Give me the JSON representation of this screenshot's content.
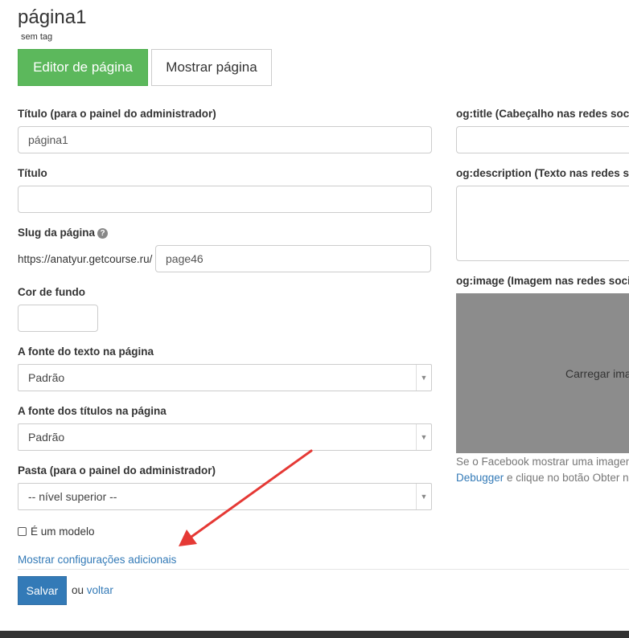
{
  "header": {
    "title": "página1",
    "tagline": "sem tag"
  },
  "tabs": {
    "editor_label": "Editor de página",
    "show_label": "Mostrar página"
  },
  "form": {
    "admin_title_label": "Título (para o painel do administrador)",
    "admin_title_value": "página1",
    "title_label": "Título",
    "title_value": "",
    "slug_label": "Slug da página",
    "slug_help_icon": "question-circle-icon",
    "slug_prefix": "https://anatyur.getcourse.ru/",
    "slug_value": "page46",
    "bg_color_label": "Cor de fundo",
    "bg_color_value": "",
    "text_font_label": "A fonte do texto na página",
    "text_font_value": "Padrão",
    "heading_font_label": "A fonte dos títulos na página",
    "heading_font_value": "Padrão",
    "folder_label": "Pasta (para o painel do administrador)",
    "folder_value": "-- nível superior --",
    "template_checkbox_label": "É um modelo",
    "template_checked": false,
    "more_settings_link": "Mostrar configurações adicionais"
  },
  "og": {
    "title_label": "og:title (Cabeçalho nas redes socia",
    "title_value": "",
    "description_label": "og:description (Texto nas redes so",
    "description_value": "",
    "image_label": "og:image (Imagem nas redes socia",
    "upload_text": "Carregar ima",
    "facebook_note_1": "Se o Facebook mostrar uma imagen",
    "debugger_link": "Debugger",
    "facebook_note_2": " e clique no botão Obter n"
  },
  "actions": {
    "save_label": "Salvar",
    "or_text": "ou",
    "back_link": "voltar"
  },
  "colors": {
    "primary_green": "#5cb85c",
    "primary_blue": "#337ab7",
    "upload_gray": "#8c8c8c",
    "annotation_red": "#e53935"
  }
}
